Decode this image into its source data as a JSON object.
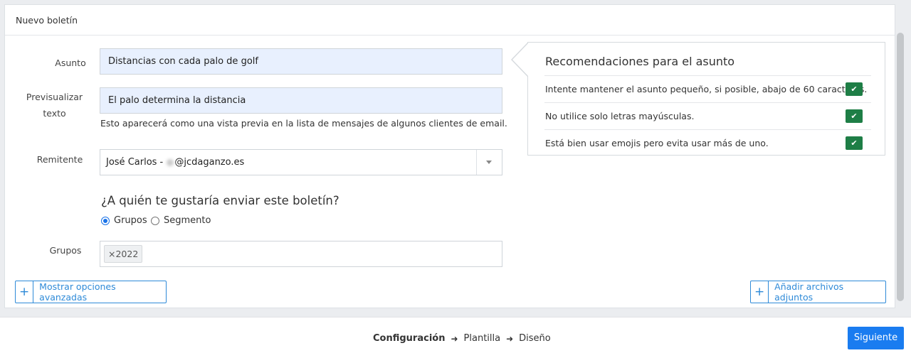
{
  "card": {
    "title": "Nuevo boletín"
  },
  "form": {
    "subject_label": "Asunto",
    "subject_value": "Distancias con cada palo de golf",
    "preview_label_1": "Previsualizar",
    "preview_label_2": "texto",
    "preview_value": "El palo determina la distancia",
    "preview_help": "Esto aparecerá como una vista previa en la lista de mensajes de algunos clientes de email.",
    "sender_label": "Remitente",
    "sender_name": "José Carlos - ",
    "sender_domain": "@jcdaganzo.es",
    "question": "¿A quién te gustaría enviar este boletín?",
    "radio_groups": "Grupos",
    "radio_segment": "Segmento",
    "selected_radio": "Grupos",
    "groups_label": "Grupos",
    "group_tag": "×2022"
  },
  "recommendations": {
    "title": "Recomendaciones para el asunto",
    "items": [
      "Intente mantener el asunto pequeño, si posible, abajo de 60 caracteres.",
      "No utilice solo letras mayúsculas.",
      "Está bien usar emojis pero evita usar más de uno."
    ]
  },
  "buttons": {
    "advanced": "Mostrar opciones avanzadas",
    "attachments": "Añadir archivos adjuntos",
    "plus": "+",
    "next": "Siguiente"
  },
  "steps": {
    "config": "Configuración",
    "template": "Plantilla",
    "design": "Diseño"
  },
  "colors": {
    "accent": "#1a7cf0",
    "check_green": "#1e7e46",
    "filled_input": "#e8f0fe"
  }
}
